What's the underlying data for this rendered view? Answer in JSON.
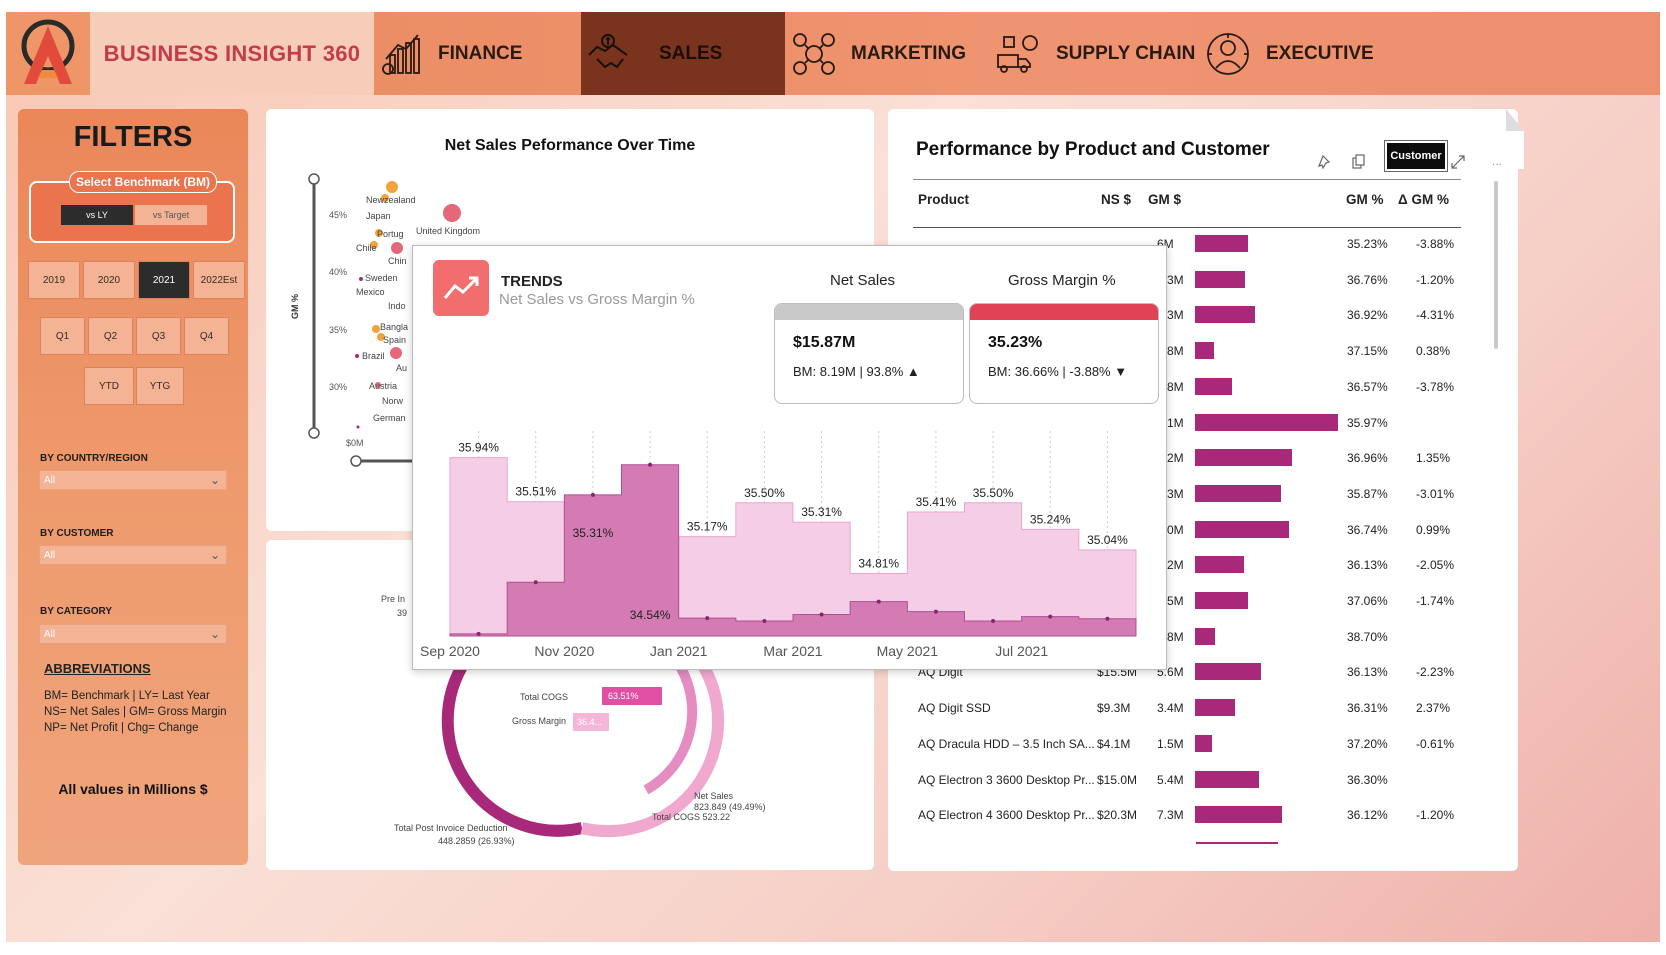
{
  "brand": {
    "title": "BUSINESS INSIGHT 360"
  },
  "nav": [
    {
      "label": "FINANCE",
      "icon": "finance-chart-icon",
      "active": false
    },
    {
      "label": "SALES",
      "icon": "handshake-icon",
      "active": true
    },
    {
      "label": "MARKETING",
      "icon": "marketing-icon",
      "active": false
    },
    {
      "label": "SUPPLY CHAIN",
      "icon": "supply-chain-icon",
      "active": false
    },
    {
      "label": "EXECUTIVE",
      "icon": "executive-icon",
      "active": false
    }
  ],
  "filters": {
    "title": "FILTERS",
    "benchmark": {
      "label": "Select Benchmark (BM)",
      "options": [
        "vs LY",
        "vs Target"
      ],
      "selected": "vs LY"
    },
    "years": [
      "2019",
      "2020",
      "2021",
      "2022Est"
    ],
    "year_selected": "2021",
    "quarters": [
      "Q1",
      "Q2",
      "Q3",
      "Q4"
    ],
    "periods": [
      "YTD",
      "YTG"
    ],
    "country": {
      "label": "BY COUNTRY/REGION",
      "value": "All"
    },
    "customer": {
      "label": "BY CUSTOMER",
      "value": "All"
    },
    "category": {
      "label": "BY CATEGORY",
      "value": "All"
    },
    "abbreviations_title": "ABBREVIATIONS",
    "abbreviations": [
      "BM= Benchmark | LY= Last Year",
      "NS= Net Sales | GM= Gross Margin",
      "NP= Net Profit | Chg= Change"
    ],
    "note": "All values in Millions $"
  },
  "net_sales_panel": {
    "title": "Net Sales Peformance Over Time",
    "y_axis_label": "GM %",
    "y_ticks": [
      "45%",
      "40%",
      "35%",
      "30%"
    ],
    "x_tick": "$0M",
    "countries": [
      "Newzealand",
      "Japan",
      "Portug",
      "United Kingdom",
      "Chile",
      "Chin",
      "Sweden",
      "Mexico",
      "Indo",
      "Bangla",
      "Spain",
      "Brazil",
      "Au",
      "Austria",
      "Norw",
      "German"
    ]
  },
  "waterfall_panel": {
    "labels": [
      "Pre In",
      "39",
      "Total COGS",
      "63.51%",
      "Gross Margin",
      "36.4...",
      "Net Sales",
      "823.849 (49.49%)",
      "Total COGS 523.22",
      "Total Post Invoice Deduction",
      "448.2859 (26.93%)"
    ]
  },
  "tooltip": {
    "title": "TRENDS",
    "subtitle": "Net Sales vs Gross Margin %",
    "net_sales": {
      "header": "Net Sales",
      "value": "$15.87M",
      "bm": "BM: 8.19M | 93.8% ▲",
      "color": "#c9c9c9"
    },
    "gross_margin": {
      "header": "Gross Margin %",
      "value": "35.23%",
      "bm": "BM: 36.66% | -3.88% ▼",
      "color": "#e04355"
    }
  },
  "chart_data": {
    "type": "area",
    "x": [
      "Sep 2020",
      "Oct 2020",
      "Nov 2020",
      "Dec 2020",
      "Jan 2021",
      "Feb 2021",
      "Mar 2021",
      "Apr 2021",
      "May 2021",
      "Jun 2021",
      "Jul 2021",
      "Aug 2021"
    ],
    "x_tick_labels": [
      "Sep 2020",
      "Nov 2020",
      "Jan 2021",
      "Mar 2021",
      "May 2021",
      "Jul 2021"
    ],
    "series": [
      {
        "name": "Gross Margin %",
        "values": [
          35.94,
          35.51,
          35.31,
          34.54,
          35.17,
          35.5,
          35.31,
          34.81,
          35.41,
          35.5,
          35.24,
          35.04
        ],
        "labels": [
          "35.94%",
          "35.51%",
          "35.31%",
          "34.54%",
          "35.17%",
          "35.50%",
          "35.31%",
          "34.81%",
          "35.41%",
          "35.50%",
          "35.24%",
          "35.04%"
        ]
      },
      {
        "name": "Net Sales",
        "values": [
          0.3,
          7.5,
          19.7,
          23.9,
          2.5,
          2.1,
          3.0,
          4.8,
          3.4,
          2.1,
          2.7,
          2.4
        ]
      }
    ],
    "gm_ylim": [
      34.2,
      36.2
    ]
  },
  "perf_panel": {
    "title": "Performance by Product and Customer",
    "toggle": "Customer",
    "columns": [
      "Product",
      "NS $",
      "GM $",
      "GM %",
      "Δ GM %"
    ],
    "rows": [
      {
        "product": "",
        "ns": "",
        "gm": "6M",
        "bar": 0.37,
        "gmp": "35.23%",
        "dgm": "-3.88%"
      },
      {
        "product": "",
        "ns": "",
        "gm": "3.3M",
        "bar": 0.35,
        "gmp": "36.76%",
        "dgm": "-1.20%"
      },
      {
        "product": "",
        "ns": "",
        "gm": "3.3M",
        "bar": 0.42,
        "gmp": "36.92%",
        "dgm": "-4.31%"
      },
      {
        "product": "",
        "ns": "",
        "gm": "1.8M",
        "bar": 0.13,
        "gmp": "37.15%",
        "dgm": "0.38%"
      },
      {
        "product": "",
        "ns": "",
        "gm": "3.8M",
        "bar": 0.26,
        "gmp": "36.57%",
        "dgm": "-3.78%"
      },
      {
        "product": "",
        "ns": "",
        "gm": "2.1M",
        "bar": 1.0,
        "gmp": "35.97%",
        "dgm": ""
      },
      {
        "product": "",
        "ns": "",
        "gm": "3.2M",
        "bar": 0.68,
        "gmp": "36.96%",
        "dgm": "1.35%"
      },
      {
        "product": "",
        "ns": "",
        "gm": "7.3M",
        "bar": 0.6,
        "gmp": "35.87%",
        "dgm": "-3.01%"
      },
      {
        "product": "",
        "ns": "",
        "gm": "3.0M",
        "bar": 0.66,
        "gmp": "36.74%",
        "dgm": "0.99%"
      },
      {
        "product": "",
        "ns": "",
        "gm": "4.2M",
        "bar": 0.34,
        "gmp": "36.13%",
        "dgm": "-2.05%"
      },
      {
        "product": "",
        "ns": "",
        "gm": "4.5M",
        "bar": 0.37,
        "gmp": "37.06%",
        "dgm": "-1.74%"
      },
      {
        "product": "",
        "ns": "",
        "gm": "1.8M",
        "bar": 0.14,
        "gmp": "38.70%",
        "dgm": ""
      },
      {
        "product": "AQ Digit",
        "ns": "$15.5M",
        "gm": "5.6M",
        "bar": 0.46,
        "gmp": "36.13%",
        "dgm": "-2.23%"
      },
      {
        "product": "AQ Digit SSD",
        "ns": "$9.3M",
        "gm": "3.4M",
        "bar": 0.28,
        "gmp": "36.31%",
        "dgm": "2.37%"
      },
      {
        "product": "AQ Dracula HDD – 3.5 Inch SA...",
        "ns": "$4.1M",
        "gm": "1.5M",
        "bar": 0.12,
        "gmp": "37.20%",
        "dgm": "-0.61%"
      },
      {
        "product": "AQ Electron 3 3600 Desktop Pr...",
        "ns": "$15.0M",
        "gm": "5.4M",
        "bar": 0.45,
        "gmp": "36.30%",
        "dgm": ""
      },
      {
        "product": "AQ Electron 4 3600 Desktop Pr...",
        "ns": "$20.3M",
        "gm": "7.3M",
        "bar": 0.61,
        "gmp": "36.12%",
        "dgm": "-1.20%"
      }
    ]
  }
}
